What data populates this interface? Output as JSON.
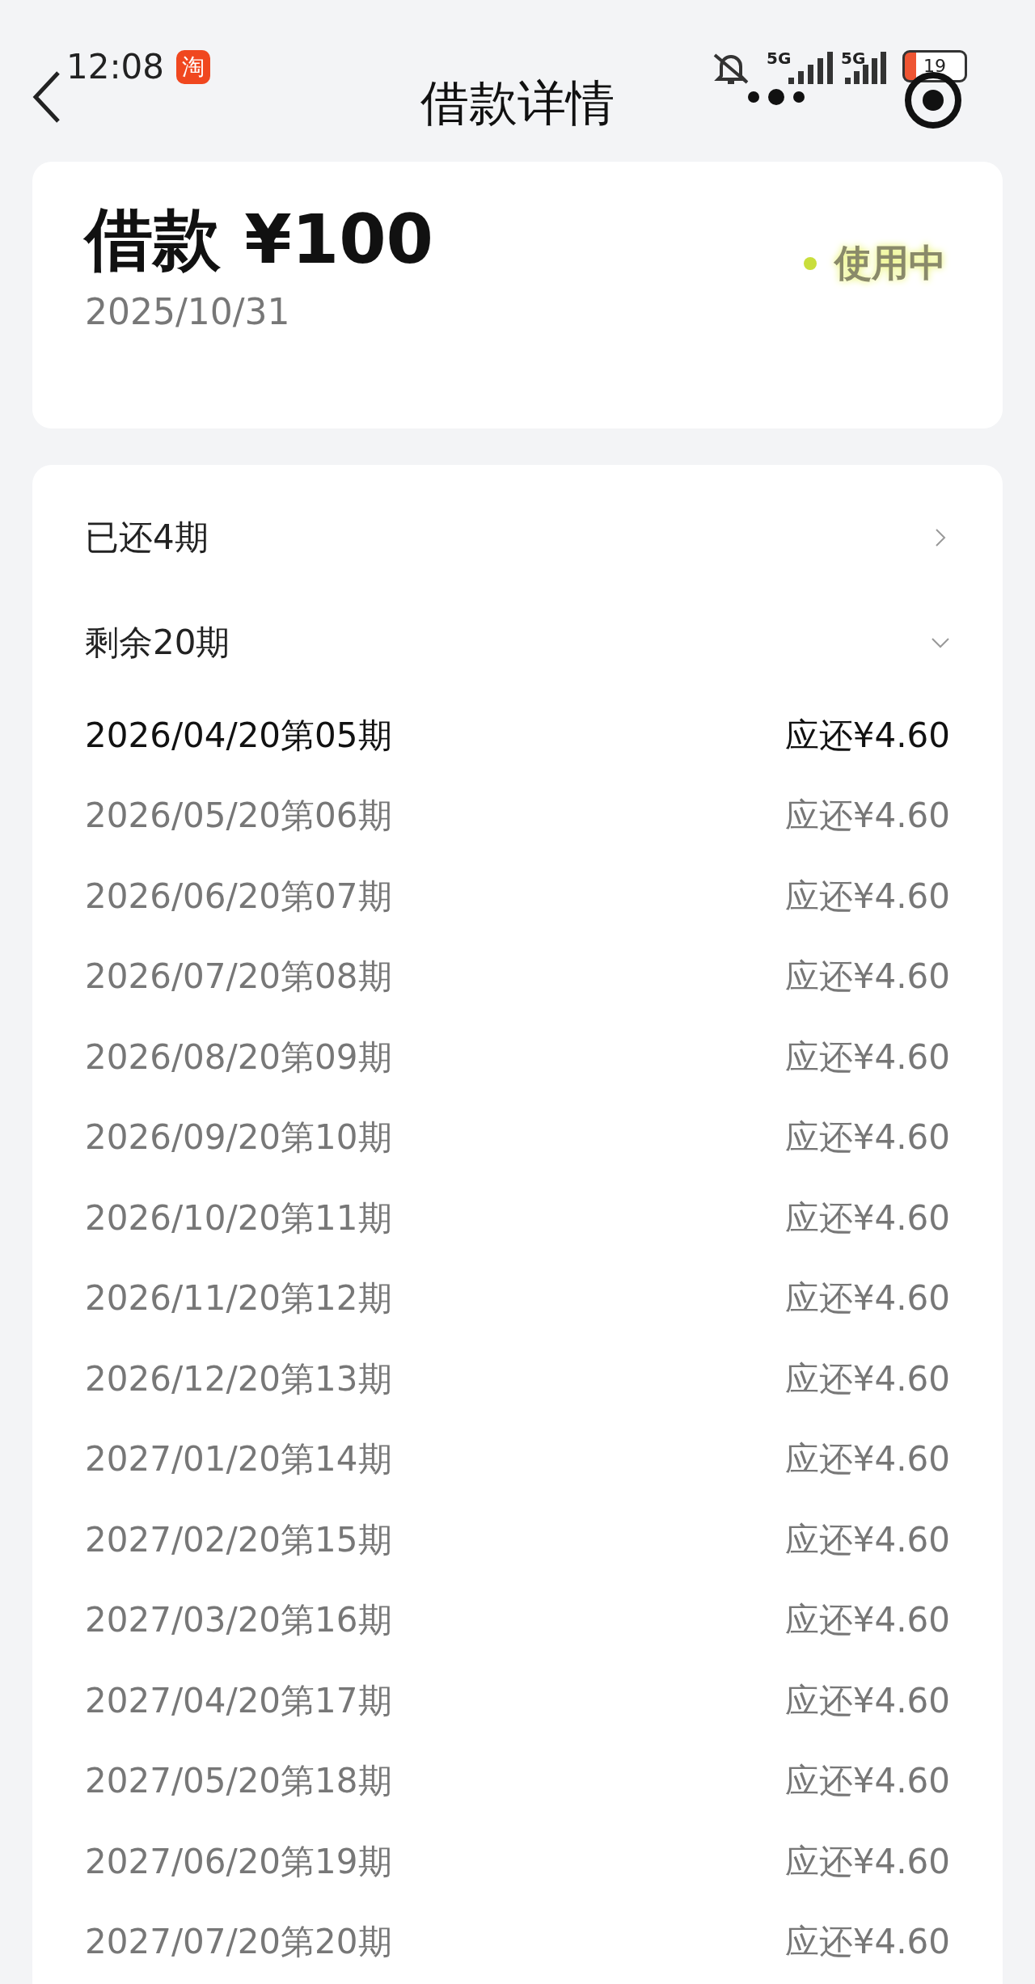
{
  "status_bar": {
    "time": "12:08",
    "app_badge": "淘",
    "network_1": "5G",
    "network_2": "5G",
    "battery": "19"
  },
  "nav": {
    "title": "借款详情"
  },
  "loan": {
    "amount": "借款 ¥100",
    "date": "2025/10/31",
    "status": "使用中"
  },
  "summary": [
    {
      "label": "已还4期",
      "expanded": false
    },
    {
      "label": "剩余20期",
      "expanded": true
    }
  ],
  "installments": [
    {
      "period": "2026/04/20第05期",
      "amount": "应还¥4.60",
      "current": true
    },
    {
      "period": "2026/05/20第06期",
      "amount": "应还¥4.60",
      "current": false
    },
    {
      "period": "2026/06/20第07期",
      "amount": "应还¥4.60",
      "current": false
    },
    {
      "period": "2026/07/20第08期",
      "amount": "应还¥4.60",
      "current": false
    },
    {
      "period": "2026/08/20第09期",
      "amount": "应还¥4.60",
      "current": false
    },
    {
      "period": "2026/09/20第10期",
      "amount": "应还¥4.60",
      "current": false
    },
    {
      "period": "2026/10/20第11期",
      "amount": "应还¥4.60",
      "current": false
    },
    {
      "period": "2026/11/20第12期",
      "amount": "应还¥4.60",
      "current": false
    },
    {
      "period": "2026/12/20第13期",
      "amount": "应还¥4.60",
      "current": false
    },
    {
      "period": "2027/01/20第14期",
      "amount": "应还¥4.60",
      "current": false
    },
    {
      "period": "2027/02/20第15期",
      "amount": "应还¥4.60",
      "current": false
    },
    {
      "period": "2027/03/20第16期",
      "amount": "应还¥4.60",
      "current": false
    },
    {
      "period": "2027/04/20第17期",
      "amount": "应还¥4.60",
      "current": false
    },
    {
      "period": "2027/05/20第18期",
      "amount": "应还¥4.60",
      "current": false
    },
    {
      "period": "2027/06/20第19期",
      "amount": "应还¥4.60",
      "current": false
    },
    {
      "period": "2027/07/20第20期",
      "amount": "应还¥4.60",
      "current": false
    }
  ]
}
